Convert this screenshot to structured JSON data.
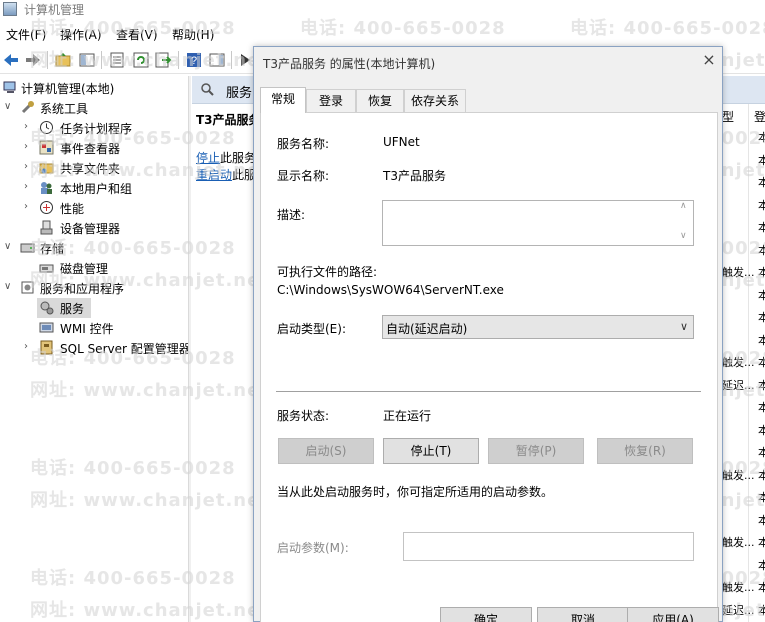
{
  "window": {
    "title": "计算机管理"
  },
  "menu": {
    "file": "文件(F)",
    "action": "操作(A)",
    "view": "查看(V)",
    "help": "帮助(H)"
  },
  "tree": {
    "root": "计算机管理(本地)",
    "system_tools": "系统工具",
    "task_scheduler": "任务计划程序",
    "event_viewer": "事件查看器",
    "shared_folders": "共享文件夹",
    "local_users": "本地用户和组",
    "performance": "性能",
    "device_manager": "设备管理器",
    "storage": "存储",
    "disk_management": "磁盘管理",
    "services_apps": "服务和应用程序",
    "services": "服务",
    "wmi": "WMI 控件",
    "sql_server": "SQL Server 配置管理器"
  },
  "services_pane": {
    "header": "服务",
    "left_title": "T3产品服务",
    "stop_link": "停止",
    "stop_suffix": "此服务",
    "restart_link": "重启动",
    "restart_suffix": "此服",
    "col_type": "型",
    "col_login": "登",
    "rows": [
      {
        "type": "",
        "login": "本"
      },
      {
        "type": "",
        "login": "本"
      },
      {
        "type": "",
        "login": "本"
      },
      {
        "type": "",
        "login": "本"
      },
      {
        "type": "",
        "login": "本"
      },
      {
        "type": "",
        "login": "本"
      },
      {
        "type": "触发...",
        "login": "本"
      },
      {
        "type": "",
        "login": "本"
      },
      {
        "type": "",
        "login": "本"
      },
      {
        "type": "",
        "login": "本"
      },
      {
        "type": "触发...",
        "login": "本"
      },
      {
        "type": "延迟...",
        "login": "本"
      },
      {
        "type": "",
        "login": "本"
      },
      {
        "type": "",
        "login": "本"
      },
      {
        "type": "",
        "login": "本"
      },
      {
        "type": "触发...",
        "login": "本"
      },
      {
        "type": "",
        "login": "本"
      },
      {
        "type": "",
        "login": "本"
      },
      {
        "type": "触发...",
        "login": "本"
      },
      {
        "type": "",
        "login": "本"
      },
      {
        "type": "触发...",
        "login": "本"
      },
      {
        "type": "延迟...",
        "login": "本"
      },
      {
        "type": "",
        "login": "本"
      }
    ]
  },
  "watermark": {
    "phone": "电话: 400-665-0028",
    "site": "网址: www.chanjet.net"
  },
  "dialog": {
    "title": "T3产品服务 的属性(本地计算机)",
    "tabs": [
      "常规",
      "登录",
      "恢复",
      "依存关系"
    ],
    "service_name_label": "服务名称:",
    "service_name": "UFNet",
    "display_name_label": "显示名称:",
    "display_name": "T3产品服务",
    "description_label": "描述:",
    "path_label": "可执行文件的路径:",
    "path": "C:\\Windows\\SysWOW64\\ServerNT.exe",
    "startup_type_label": "启动类型(E):",
    "startup_type": "自动(延迟启动)",
    "status_label": "服务状态:",
    "status": "正在运行",
    "btn_start": "启动(S)",
    "btn_stop": "停止(T)",
    "btn_pause": "暂停(P)",
    "btn_resume": "恢复(R)",
    "hint": "当从此处启动服务时，你可指定所适用的启动参数。",
    "params_label": "启动参数(M):",
    "ok": "确定",
    "cancel": "取消",
    "apply": "应用(A)"
  }
}
